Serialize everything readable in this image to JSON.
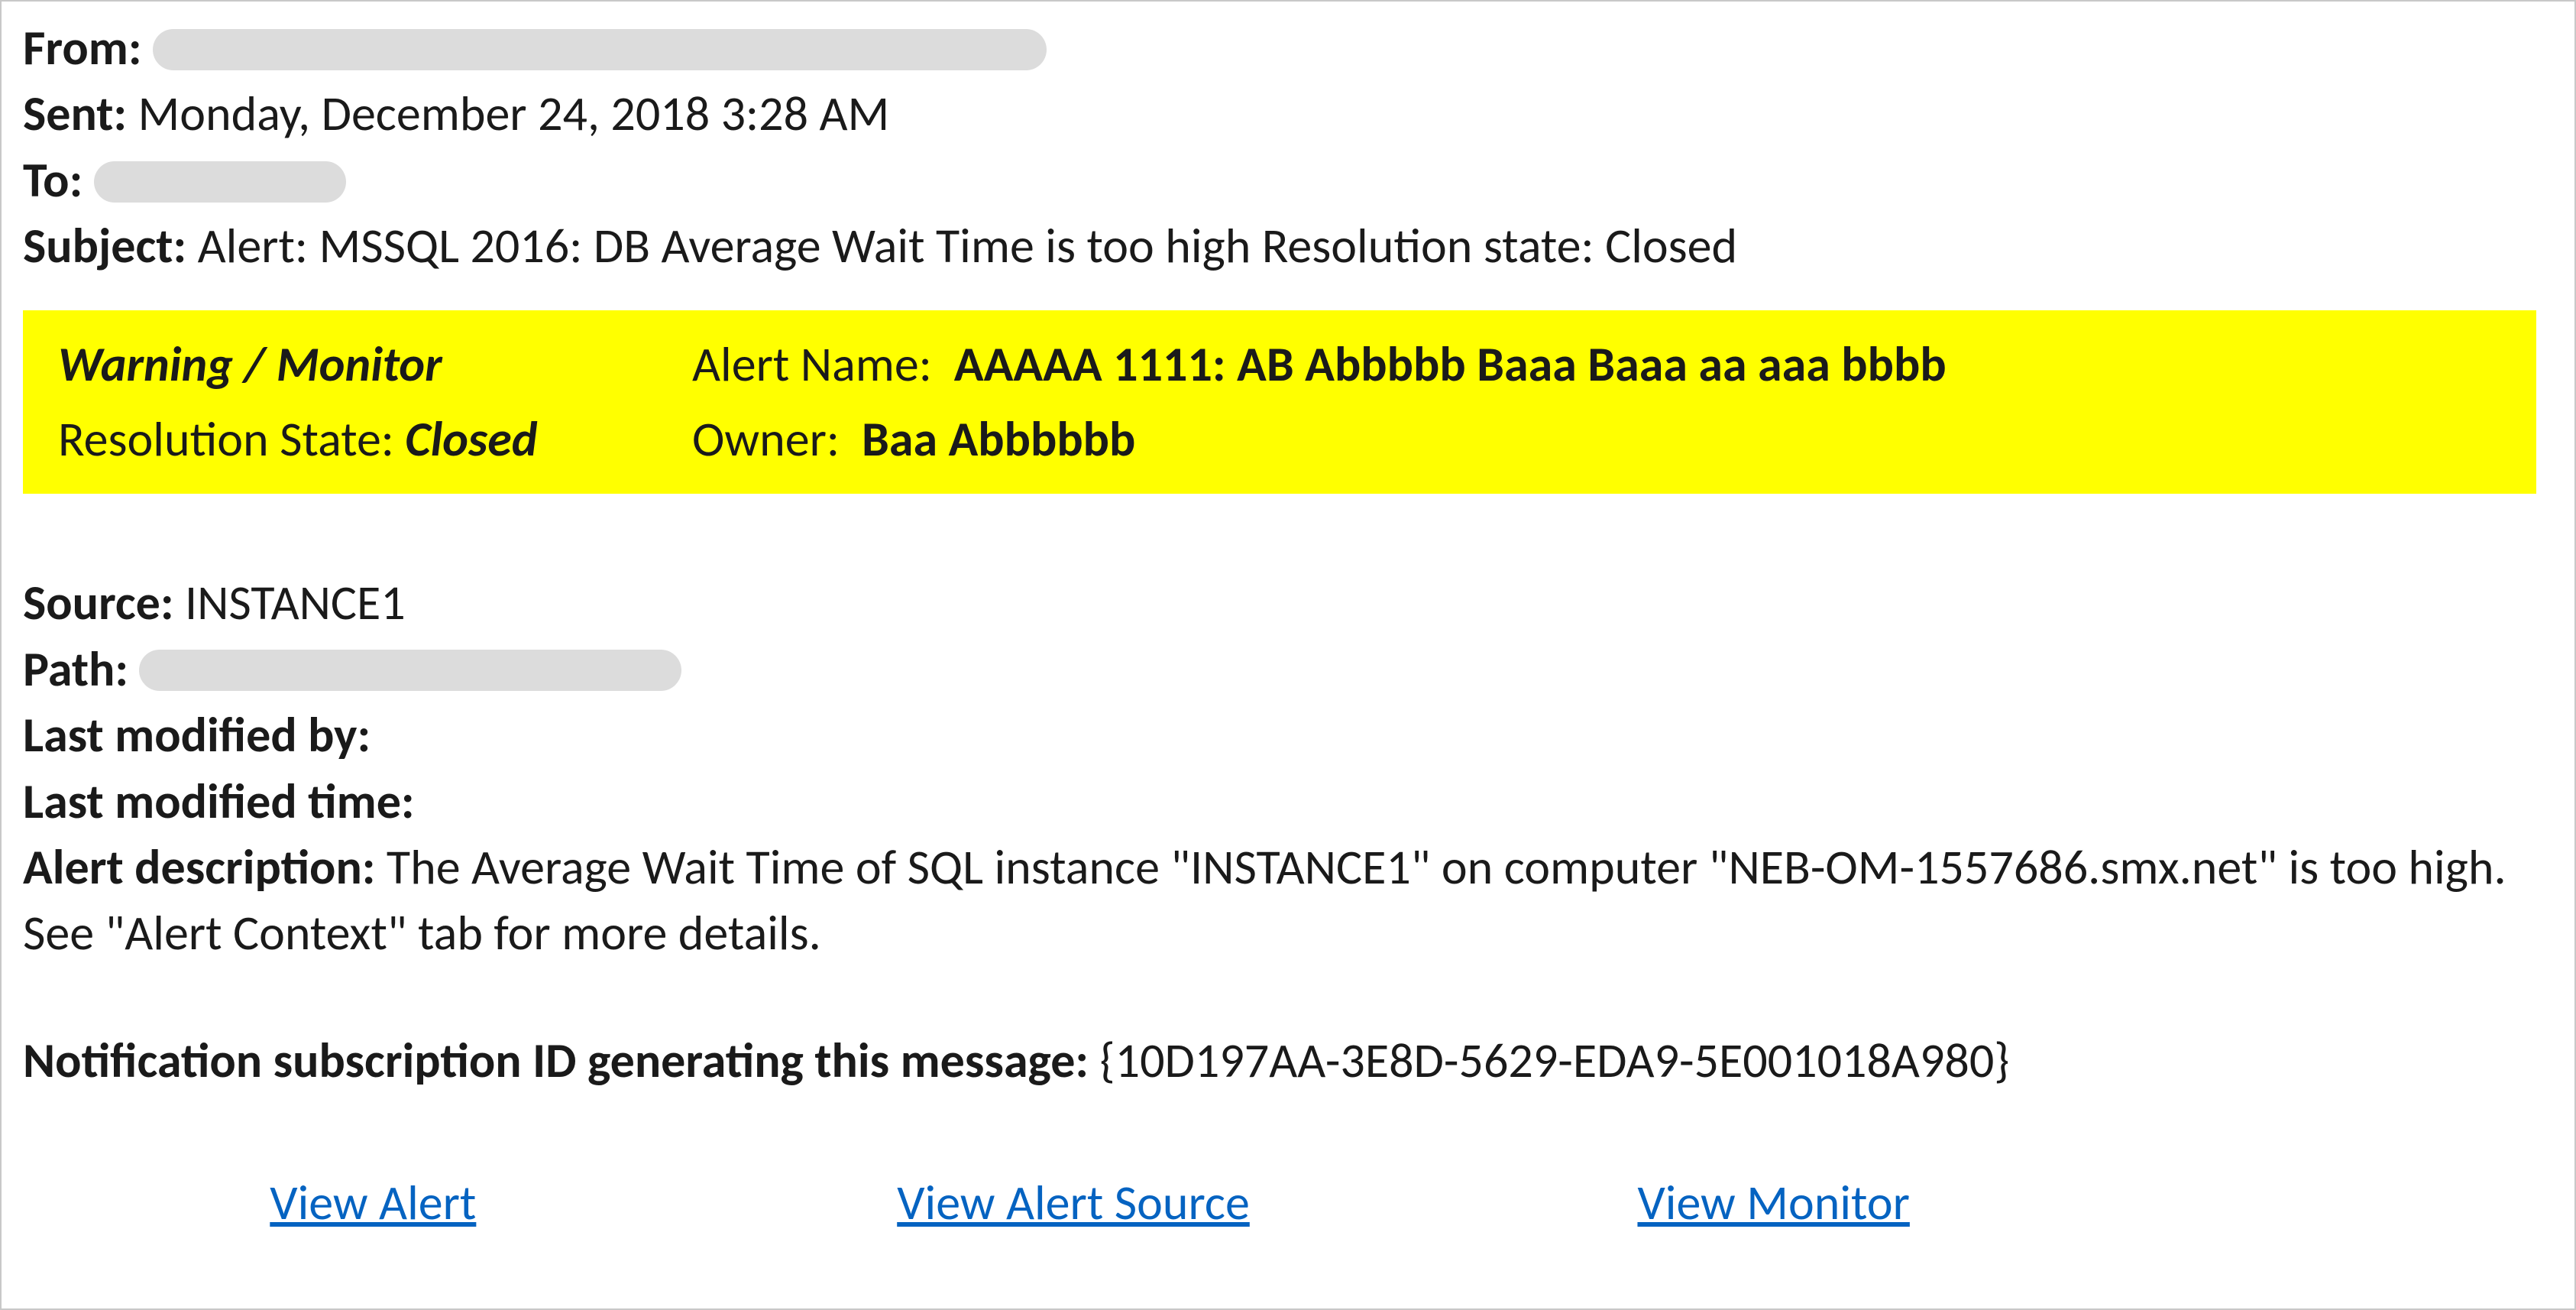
{
  "header": {
    "from_label": "From:",
    "sent_label": "Sent:",
    "sent_value": "Monday, December 24, 2018 3:28 AM",
    "to_label": "To:",
    "subject_label": "Subject:",
    "subject_value": "Alert: MSSQL 2016: DB Average Wait Time is too high Resolution state: Closed"
  },
  "banner": {
    "warning_label": "Warning / Monitor",
    "alert_name_label": "Alert Name:",
    "alert_name_value": "AAAAA 1111: AB Abbbbb Baaa Baaa aa aaa bbbb",
    "resolution_label": "Resolution State:",
    "resolution_value": "Closed",
    "owner_label": "Owner:",
    "owner_value": "Baa Abbbbbb"
  },
  "body": {
    "source_label": "Source:",
    "source_value": "INSTANCE1",
    "path_label": "Path:",
    "last_modified_by_label": "Last modified by:",
    "last_modified_by_value": "",
    "last_modified_time_label": "Last modified time:",
    "last_modified_time_value": "",
    "alert_description_label": "Alert description:",
    "alert_description_value": "The Average Wait Time of SQL instance \"INSTANCE1\" on computer \"NEB-OM-1557686.smx.net\" is too high. See \"Alert Context\" tab for more details.",
    "subscription_label": "Notification subscription ID generating this message:",
    "subscription_value": "{10D197AA-3E8D-5629-EDA9-5E001018A980}"
  },
  "links": {
    "view_alert": "View Alert",
    "view_alert_source": "View Alert Source",
    "view_monitor": "View Monitor"
  }
}
